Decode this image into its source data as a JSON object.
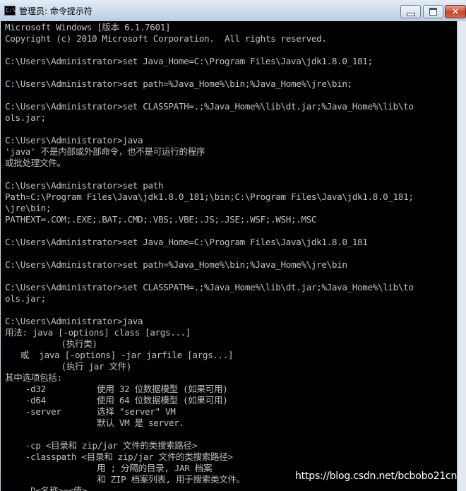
{
  "window": {
    "title": "管理员: 命令提示符",
    "icon_label": "C:\\",
    "min_icon": "minimize-icon",
    "max_icon": "maximize-icon",
    "close_icon": "close-icon",
    "close_glyph": "✕"
  },
  "console": {
    "lines": [
      "Microsoft Windows [版本 6.1.7601]",
      "Copyright (c) 2010 Microsoft Corporation.  All rights reserved.",
      "",
      "C:\\Users\\Administrator>set Java_Home=C:\\Program Files\\Java\\jdk1.8.0_181;",
      "",
      "C:\\Users\\Administrator>set path=%Java_Home%\\bin;%Java_Home%\\jre\\bin;",
      "",
      "C:\\Users\\Administrator>set CLASSPATH=.;%Java_Home%\\lib\\dt.jar;%Java_Home%\\lib\\to",
      "ols.jar;",
      "",
      "C:\\Users\\Administrator>java",
      "'java' 不是内部或外部命令，也不是可运行的程序",
      "或批处理文件。",
      "",
      "C:\\Users\\Administrator>set path",
      "Path=C:\\Program Files\\Java\\jdk1.8.0_181;\\bin;C:\\Program Files\\Java\\jdk1.8.0_181;",
      "\\jre\\bin;",
      "PATHEXT=.COM;.EXE;.BAT;.CMD;.VBS;.VBE;.JS;.JSE;.WSF;.WSH;.MSC",
      "",
      "C:\\Users\\Administrator>set Java_Home=C:\\Program Files\\Java\\jdk1.8.0_181",
      "",
      "C:\\Users\\Administrator>set path=%Java_Home%\\bin;%Java_Home%\\jre\\bin",
      "",
      "C:\\Users\\Administrator>set CLASSPATH=.;%Java_Home%\\lib\\dt.jar;%Java_Home%\\lib\\to",
      "ols.jar;",
      "",
      "C:\\Users\\Administrator>java",
      "用法: java [-options] class [args...]",
      "           (执行类)",
      "   或  java [-options] -jar jarfile [args...]",
      "           (执行 jar 文件)",
      "其中选项包括:",
      "    -d32          使用 32 位数据模型 (如果可用)",
      "    -d64          使用 64 位数据模型 (如果可用)",
      "    -server       选择 \"server\" VM",
      "                  默认 VM 是 server.",
      "",
      "    -cp <目录和 zip/jar 文件的类搜索路径>",
      "    -classpath <目录和 zip/jar 文件的类搜索路径>",
      "                  用 ; 分隔的目录, JAR 档案",
      "                  和 ZIP 档案列表, 用于搜索类文件。",
      "    -D<名称>=<值>"
    ]
  },
  "watermark": "https://blog.csdn.net/bcbobo21cn"
}
